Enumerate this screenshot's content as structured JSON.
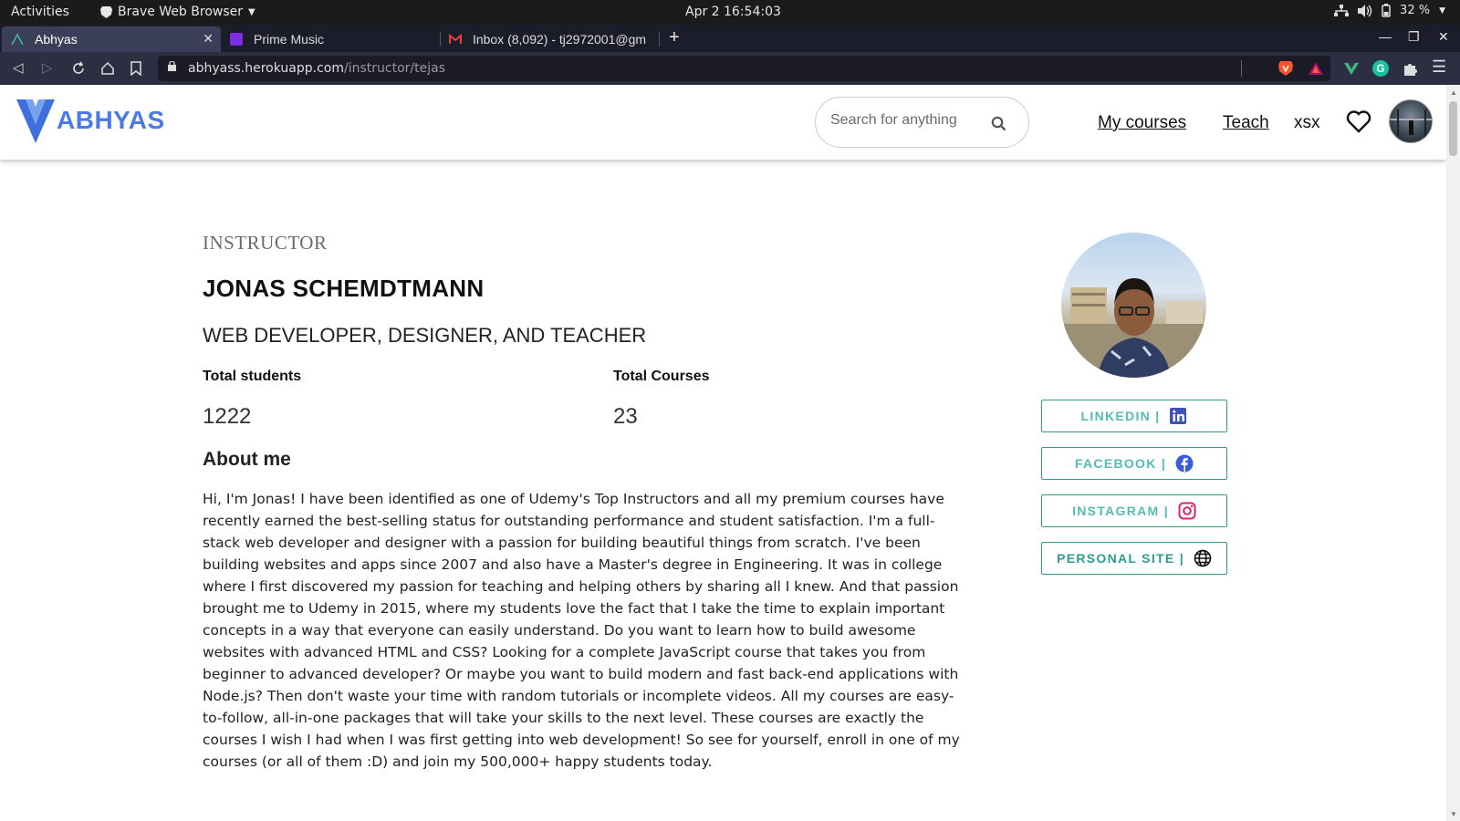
{
  "os": {
    "activities": "Activities",
    "app_name": "Brave Web Browser",
    "clock": "Apr 2  16:54:03",
    "battery": "32 %"
  },
  "browser": {
    "tabs": [
      {
        "label": "Abhyas",
        "active": true
      },
      {
        "label": "Prime Music",
        "active": false
      },
      {
        "label": "Inbox (8,092) - tj2972001@gm",
        "active": false
      }
    ],
    "url_host": "abhyass.herokuapp.com",
    "url_path": "/instructor/tejas"
  },
  "site": {
    "brand": "ABHYAS",
    "brand_color": "#4c79e8",
    "search_placeholder": "Search for anything",
    "nav": {
      "my_courses": "My courses",
      "teach": "Teach",
      "username": "xsx"
    }
  },
  "instructor": {
    "kicker": "INSTRUCTOR",
    "name": "JONAS SCHEMDTMANN",
    "headline": "WEB DEVELOPER, DESIGNER, AND TEACHER",
    "stats": {
      "students_label": "Total students",
      "students_value": "1222",
      "courses_label": "Total Courses",
      "courses_value": "23"
    },
    "about_heading": "About me",
    "about_text": "Hi, I'm Jonas! I have been identified as one of Udemy's Top Instructors and all my premium courses have recently earned the best-selling status for outstanding performance and student satisfaction. I'm a full-stack web developer and designer with a passion for building beautiful things from scratch. I've been building websites and apps since 2007 and also have a Master's degree in Engineering. It was in college where I first discovered my passion for teaching and helping others by sharing all I knew. And that passion brought me to Udemy in 2015, where my students love the fact that I take the time to explain important concepts in a way that everyone can easily understand. Do you want to learn how to build awesome websites with advanced HTML and CSS? Looking for a complete JavaScript course that takes you from beginner to advanced developer? Or maybe you want to build modern and fast back-end applications with Node.js? Then don't waste your time with random tutorials or incomplete videos. All my courses are easy-to-follow, all-in-one packages that will take your skills to the next level. These courses are exactly the courses I wish I had when I was first getting into web development! So see for yourself, enroll in one of my courses (or all of them :D) and join my 500,000+ happy students today."
  },
  "social": {
    "linkedin": "LINKEDIN |",
    "facebook": "FACEBOOK |",
    "instagram": "INSTAGRAM |",
    "personal_site": "PERSONAL SITE |",
    "accent": "#2a9d8f"
  }
}
